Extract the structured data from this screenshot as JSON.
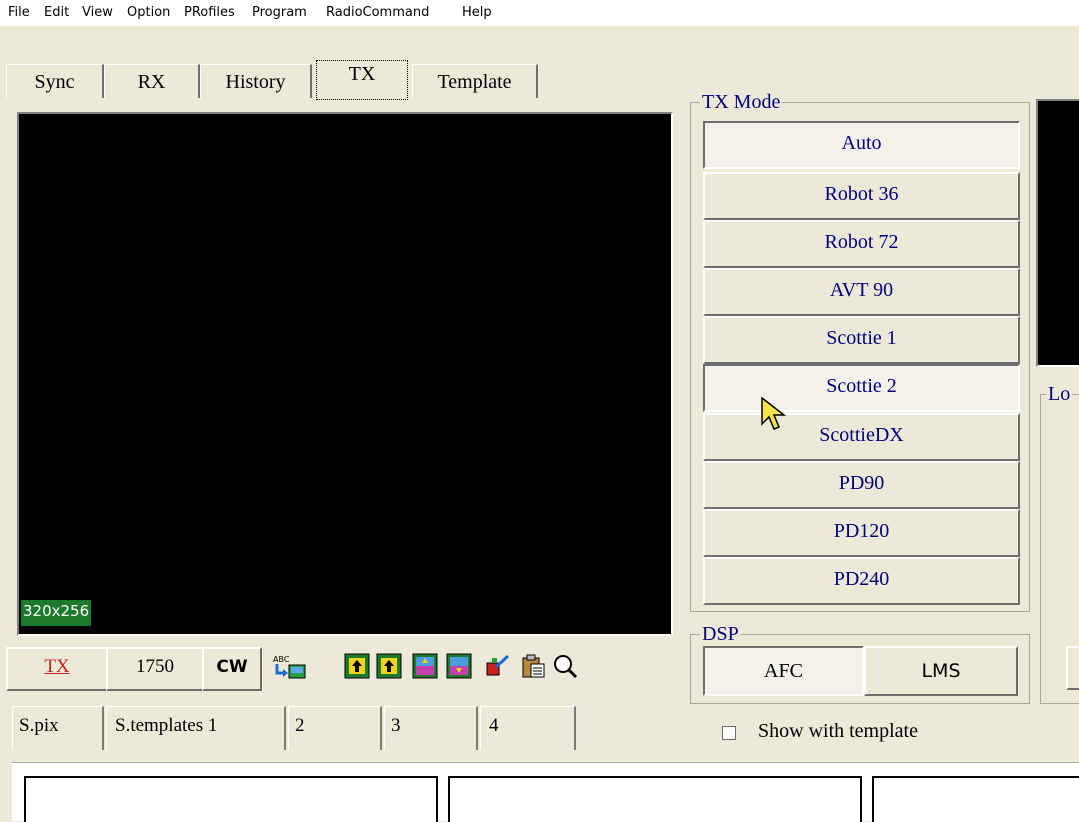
{
  "menu": [
    "File",
    "Edit",
    "View",
    "Option",
    "PRofiles",
    "Program",
    "RadioCommand",
    "Help"
  ],
  "tabs": [
    "Sync",
    "RX",
    "History",
    "TX",
    "Template"
  ],
  "active_tab": "TX",
  "image_size": "320x256",
  "tx_mode": {
    "title": "TX Mode",
    "modes": [
      "Auto",
      "Robot 36",
      "Robot 72",
      "AVT 90",
      "Scottie 1",
      "Scottie 2",
      "ScottieDX",
      "PD90",
      "PD120",
      "PD240"
    ],
    "pressed": [
      "Auto",
      "Scottie 2"
    ]
  },
  "dsp": {
    "title": "DSP",
    "afc": "AFC",
    "lms": "LMS"
  },
  "right_group_title": "Lo",
  "toolbar": {
    "tx": "TX",
    "freq": "1750",
    "cw": "CW"
  },
  "bottom_tabs": [
    "S.pix",
    "S.templates 1",
    "2",
    "3",
    "4"
  ],
  "show_with_template": {
    "label": "Show with template",
    "checked": false
  },
  "colors": {
    "size_badge": "#1d7a2c",
    "tx_label": "#c8201b",
    "mode_text": "#00007a"
  },
  "icons": [
    "text-to-image-icon",
    "move-up-icon",
    "move-up-alt-icon",
    "image-color-icon",
    "image-edit-icon",
    "paint-brush-icon",
    "clipboard-paste-icon",
    "zoom-icon"
  ]
}
